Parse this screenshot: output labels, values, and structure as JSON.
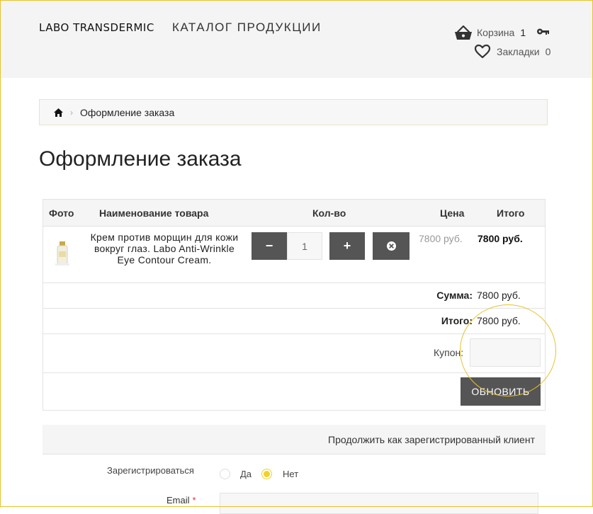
{
  "header": {
    "logo": "LABO TRANSDERMIC",
    "catalog_link": "КАТАЛОГ ПРОДУКЦИИ",
    "cart_label": "Корзина",
    "cart_count": "1",
    "bookmarks_label": "Закладки",
    "bookmarks_count": "0"
  },
  "breadcrumb": {
    "current": "Оформление заказа"
  },
  "page_title": "Оформление заказа",
  "cart_table": {
    "headers": {
      "photo": "Фото",
      "name": "Наименование товара",
      "qty": "Кол-во",
      "price": "Цена",
      "total": "Итого"
    },
    "items": [
      {
        "name": "Крем против морщин для кожи вокруг глаз. Labo Anti-Wrinkle Eye Contour Cream.",
        "qty": "1",
        "price": "7800 руб.",
        "total": "7800 руб."
      }
    ],
    "buttons": {
      "minus": "−",
      "plus": "+",
      "remove": "✖"
    },
    "sum_label": "Сумма:",
    "sum_value": "7800 руб.",
    "grand_label": "Итого:",
    "grand_value": "7800 руб.",
    "coupon_label": "Купон:",
    "update_button": "ОБНОВИТЬ"
  },
  "checkout": {
    "registered_client_link": "Продолжить как зарегистрированный клиент",
    "register_label": "Зарегистрироваться",
    "register_options": [
      "Да",
      "Нет"
    ],
    "register_selected": "Нет",
    "email_label": "Email",
    "email_required_mark": "*"
  },
  "colors": {
    "accent_yellow": "#f1d226",
    "frame_border": "#e8c22a",
    "button_dark": "#555555"
  },
  "icons": {
    "home": "home-icon",
    "cart": "basket-icon",
    "key": "key-icon",
    "heart": "heart-icon",
    "remove": "remove-icon"
  }
}
